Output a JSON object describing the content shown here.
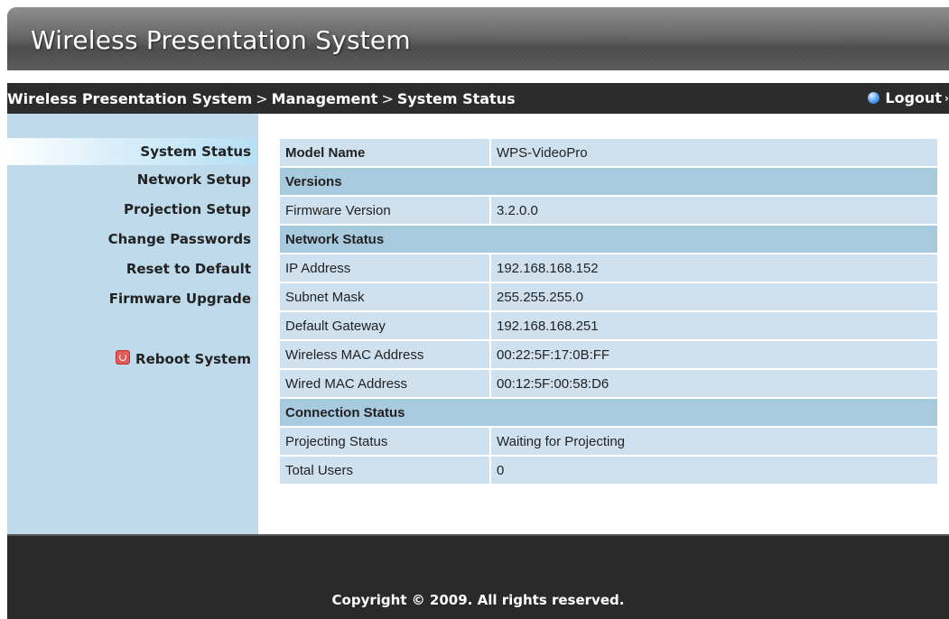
{
  "header": {
    "title": "Wireless Presentation System"
  },
  "breadcrumb": {
    "items": [
      "Wireless Presentation System",
      "Management",
      "System Status"
    ],
    "separator": ">"
  },
  "logout": {
    "label": "Logout",
    "icon": "blue-orb-icon"
  },
  "sidebar": {
    "items": [
      {
        "label": "System Status",
        "active": true
      },
      {
        "label": "Network Setup"
      },
      {
        "label": "Projection Setup"
      },
      {
        "label": "Change Passwords"
      },
      {
        "label": "Reset to Default"
      },
      {
        "label": "Firmware Upgrade"
      }
    ],
    "reboot": {
      "label": "Reboot System",
      "icon": "power-icon"
    }
  },
  "status": {
    "model_name": {
      "label": "Model Name",
      "value": "WPS-VideoPro"
    },
    "versions": {
      "heading": "Versions"
    },
    "firmware": {
      "label": "Firmware Version",
      "value": "3.2.0.0"
    },
    "network": {
      "heading": "Network Status"
    },
    "ip": {
      "label": "IP Address",
      "value": "192.168.168.152"
    },
    "subnet": {
      "label": "Subnet Mask",
      "value": "255.255.255.0"
    },
    "gateway": {
      "label": "Default Gateway",
      "value": "192.168.168.251"
    },
    "wireless_mac": {
      "label": "Wireless MAC Address",
      "value": "00:22:5F:17:0B:FF"
    },
    "wired_mac": {
      "label": "Wired MAC Address",
      "value": "00:12:5F:00:58:D6"
    },
    "connection": {
      "heading": "Connection Status"
    },
    "projecting": {
      "label": "Projecting Status",
      "value": "Waiting for Projecting"
    },
    "users": {
      "label": "Total Users",
      "value": "0"
    }
  },
  "footer": {
    "copyright": "Copyright © 2009. All rights reserved."
  },
  "colors": {
    "sidebar_bg": "#bfdbeb",
    "row_bg": "#cfe1ef",
    "section_bg": "#a8cadf",
    "bar_bg": "#2c2c2c"
  }
}
